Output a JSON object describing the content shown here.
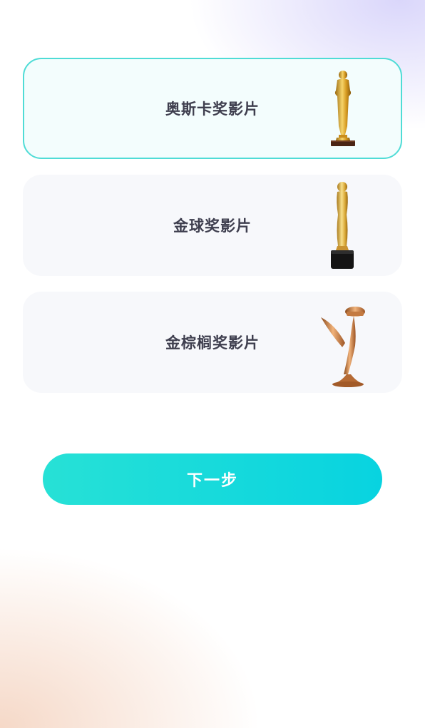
{
  "options": [
    {
      "label": "奥斯卡奖影片",
      "icon": "oscar-trophy-icon",
      "selected": true
    },
    {
      "label": "金球奖影片",
      "icon": "golden-globe-trophy-icon",
      "selected": false
    },
    {
      "label": "金棕榈奖影片",
      "icon": "palme-dor-trophy-icon",
      "selected": false
    }
  ],
  "next_button": {
    "label": "下一步"
  },
  "colors": {
    "accent_start": "#27e1d6",
    "accent_end": "#08d3e0",
    "selected_border": "#4fdcd6"
  }
}
